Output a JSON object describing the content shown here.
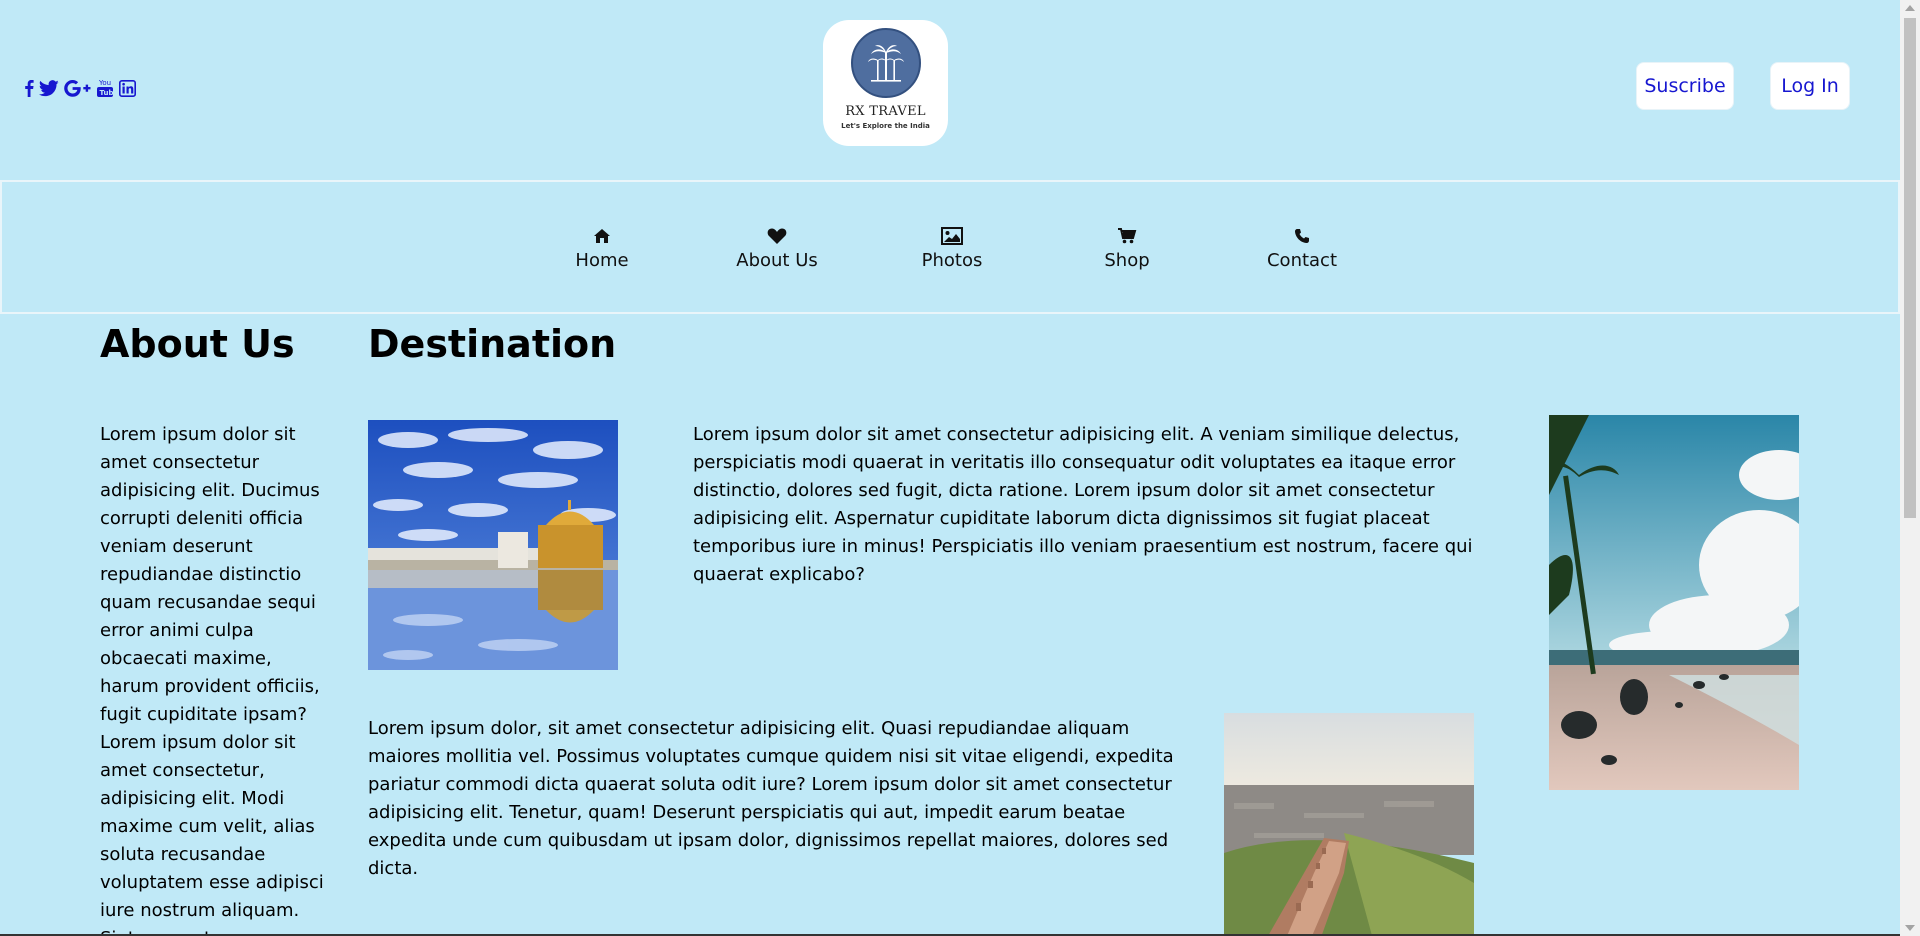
{
  "colors": {
    "page_background": "#c0e9f7",
    "link_blue": "#1717d0",
    "logo_circle": "#4f6e9f"
  },
  "header": {
    "social_icons": [
      "facebook-icon",
      "twitter-icon",
      "google-plus-icon",
      "youtube-icon",
      "linkedin-icon"
    ],
    "logo": {
      "title": "RX TRAVEL",
      "tagline": "Let's Explore the India"
    },
    "subscribe_label": "Suscribe",
    "login_label": "Log In"
  },
  "nav": {
    "items": [
      {
        "label": "Home",
        "icon": "home-icon"
      },
      {
        "label": "About Us",
        "icon": "heart-icon"
      },
      {
        "label": "Photos",
        "icon": "picture-icon"
      },
      {
        "label": "Shop",
        "icon": "cart-icon"
      },
      {
        "label": "Contact",
        "icon": "phone-icon"
      }
    ]
  },
  "about": {
    "heading": "About Us",
    "text": "Lorem ipsum dolor sit amet consectetur adipisicing elit. Ducimus corrupti deleniti officia veniam deserunt repudiandae distinctio quam recusandae sequi error animi culpa obcaecati maxime, harum provident officiis, fugit cupiditate ipsam? Lorem ipsum dolor sit amet consectetur, adipisicing elit. Modi maxime cum velit, alias soluta recusandae voluptatem esse adipisci iure nostrum aliquam. Sint quaerat"
  },
  "destination": {
    "heading": "Destination",
    "paragraph_1": "Lorem ipsum dolor sit amet consectetur adipisicing elit. A veniam similique delectus, perspiciatis modi quaerat in veritatis illo consequatur odit voluptates ea itaque error distinctio, dolores sed fugit, dicta ratione. Lorem ipsum dolor sit amet consectetur adipisicing elit. Aspernatur cupiditate laborum dicta dignissimos sit fugiat placeat temporibus iure in minus! Perspiciatis illo veniam praesentium est nostrum, facere qui quaerat explicabo?",
    "paragraph_2": "Lorem ipsum dolor, sit amet consectetur adipisicing elit. Quasi repudiandae aliquam maiores mollitia vel. Possimus voluptates cumque quidem nisi sit vitae eligendi, expedita pariatur commodi dicta quaerat soluta odit iure? Lorem ipsum dolor sit amet consectetur adipisicing elit. Tenetur, quam! Deserunt perspiciatis qui aut, impedit earum beatae expedita unde cum quibusdam ut ipsam dolor, dignissimos repellat maiores, dolores sed dicta."
  }
}
